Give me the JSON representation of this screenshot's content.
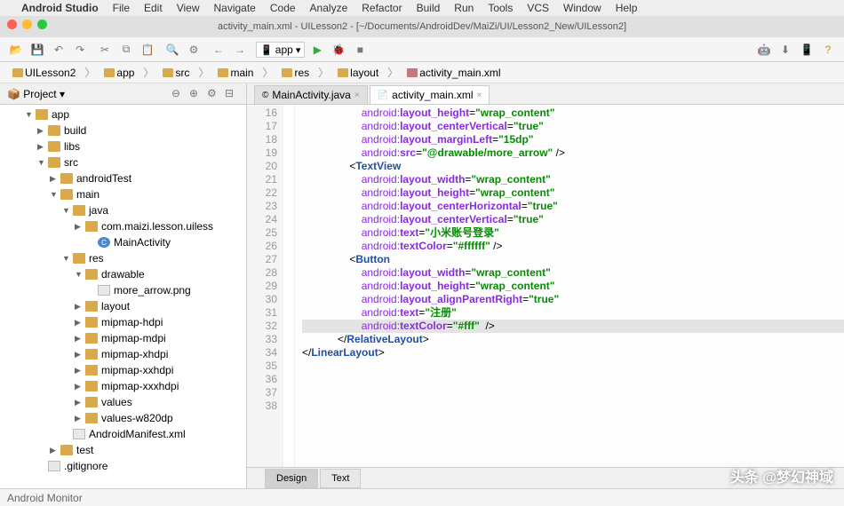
{
  "menubar": [
    "Android Studio",
    "File",
    "Edit",
    "View",
    "Navigate",
    "Code",
    "Analyze",
    "Refactor",
    "Build",
    "Run",
    "Tools",
    "VCS",
    "Window",
    "Help"
  ],
  "title": "activity_main.xml - UILesson2 - [~/Documents/AndroidDev/MaiZi/UI/Lesson2_New/UILesson2]",
  "run_config": "app",
  "breadcrumb": [
    "UILesson2",
    "app",
    "src",
    "main",
    "res",
    "layout",
    "activity_main.xml"
  ],
  "project": {
    "panel_title": "Project"
  },
  "tree": [
    {
      "d": 2,
      "e": 1,
      "t": "dir",
      "l": "app"
    },
    {
      "d": 3,
      "e": 0,
      "t": "dir",
      "l": "build"
    },
    {
      "d": 3,
      "e": 0,
      "t": "dir",
      "l": "libs"
    },
    {
      "d": 3,
      "e": 1,
      "t": "dir",
      "l": "src"
    },
    {
      "d": 4,
      "e": 0,
      "t": "dir",
      "l": "androidTest"
    },
    {
      "d": 4,
      "e": 1,
      "t": "dir",
      "l": "main"
    },
    {
      "d": 5,
      "e": 1,
      "t": "dir",
      "l": "java"
    },
    {
      "d": 6,
      "e": 0,
      "t": "dir",
      "l": "com.maizi.lesson.uiless"
    },
    {
      "d": 7,
      "e": 0,
      "t": "java",
      "l": "MainActivity"
    },
    {
      "d": 5,
      "e": 1,
      "t": "dir",
      "l": "res"
    },
    {
      "d": 6,
      "e": 1,
      "t": "dir",
      "l": "drawable"
    },
    {
      "d": 7,
      "e": 0,
      "t": "file",
      "l": "more_arrow.png"
    },
    {
      "d": 6,
      "e": 0,
      "t": "dir",
      "l": "layout"
    },
    {
      "d": 6,
      "e": 0,
      "t": "dir",
      "l": "mipmap-hdpi"
    },
    {
      "d": 6,
      "e": 0,
      "t": "dir",
      "l": "mipmap-mdpi"
    },
    {
      "d": 6,
      "e": 0,
      "t": "dir",
      "l": "mipmap-xhdpi"
    },
    {
      "d": 6,
      "e": 0,
      "t": "dir",
      "l": "mipmap-xxhdpi"
    },
    {
      "d": 6,
      "e": 0,
      "t": "dir",
      "l": "mipmap-xxxhdpi"
    },
    {
      "d": 6,
      "e": 0,
      "t": "dir",
      "l": "values"
    },
    {
      "d": 6,
      "e": 0,
      "t": "dir",
      "l": "values-w820dp"
    },
    {
      "d": 5,
      "e": 0,
      "t": "file",
      "l": "AndroidManifest.xml"
    },
    {
      "d": 4,
      "e": 0,
      "t": "dir",
      "l": "test"
    },
    {
      "d": 3,
      "e": 0,
      "t": "file",
      "l": ".gitignore"
    }
  ],
  "tabs": [
    {
      "label": "MainActivity.java",
      "active": false,
      "type": "java"
    },
    {
      "label": "activity_main.xml",
      "active": true,
      "type": "xml"
    }
  ],
  "bottom_tabs": [
    {
      "label": "Design",
      "active": true
    },
    {
      "label": "Text",
      "active": false
    }
  ],
  "statusbar_left": "Android Monitor",
  "watermark": "头条 @梦幻神域",
  "code": {
    "first_line": 16,
    "lines": [
      [
        [
          1,
          "                    "
        ],
        [
          2,
          "android:"
        ],
        [
          3,
          "layout_height"
        ],
        [
          1,
          "="
        ],
        [
          4,
          "\"wrap_content\""
        ],
        [
          1,
          ""
        ]
      ],
      [
        [
          1,
          "                    "
        ],
        [
          2,
          "android:"
        ],
        [
          3,
          "layout_centerVertical"
        ],
        [
          1,
          "="
        ],
        [
          4,
          "\"true\""
        ],
        [
          1,
          ""
        ]
      ],
      [
        [
          1,
          "                    "
        ],
        [
          2,
          "android:"
        ],
        [
          3,
          "layout_marginLeft"
        ],
        [
          1,
          "="
        ],
        [
          4,
          "\"15dp\""
        ],
        [
          1,
          ""
        ]
      ],
      [
        [
          1,
          "                    "
        ],
        [
          2,
          "android:"
        ],
        [
          3,
          "src"
        ],
        [
          1,
          "="
        ],
        [
          4,
          "\"@drawable/more_arrow\""
        ],
        [
          1,
          " />"
        ]
      ],
      [
        [
          1,
          ""
        ]
      ],
      [
        [
          1,
          "                <"
        ],
        [
          5,
          "TextView"
        ],
        [
          1,
          ""
        ]
      ],
      [
        [
          1,
          "                    "
        ],
        [
          2,
          "android:"
        ],
        [
          3,
          "layout_width"
        ],
        [
          1,
          "="
        ],
        [
          4,
          "\"wrap_content\""
        ],
        [
          1,
          ""
        ]
      ],
      [
        [
          1,
          "                    "
        ],
        [
          2,
          "android:"
        ],
        [
          3,
          "layout_height"
        ],
        [
          1,
          "="
        ],
        [
          4,
          "\"wrap_content\""
        ],
        [
          1,
          ""
        ]
      ],
      [
        [
          1,
          "                    "
        ],
        [
          2,
          "android:"
        ],
        [
          3,
          "layout_centerHorizontal"
        ],
        [
          1,
          "="
        ],
        [
          4,
          "\"true\""
        ],
        [
          1,
          ""
        ]
      ],
      [
        [
          1,
          "                    "
        ],
        [
          2,
          "android:"
        ],
        [
          3,
          "layout_centerVertical"
        ],
        [
          1,
          "="
        ],
        [
          4,
          "\"true\""
        ],
        [
          1,
          ""
        ]
      ],
      [
        [
          1,
          "                    "
        ],
        [
          2,
          "android:"
        ],
        [
          3,
          "text"
        ],
        [
          1,
          "="
        ],
        [
          6,
          "\"小米账号登录\""
        ],
        [
          1,
          ""
        ]
      ],
      [
        [
          1,
          "                    "
        ],
        [
          2,
          "android:"
        ],
        [
          3,
          "textColor"
        ],
        [
          1,
          "="
        ],
        [
          4,
          "\"#ffffff\""
        ],
        [
          1,
          " />"
        ]
      ],
      [
        [
          1,
          ""
        ]
      ],
      [
        [
          1,
          "                <"
        ],
        [
          5,
          "Button"
        ],
        [
          1,
          ""
        ]
      ],
      [
        [
          1,
          "                    "
        ],
        [
          2,
          "android:"
        ],
        [
          3,
          "layout_width"
        ],
        [
          1,
          "="
        ],
        [
          4,
          "\"wrap_content\""
        ],
        [
          1,
          ""
        ]
      ],
      [
        [
          1,
          "                    "
        ],
        [
          2,
          "android:"
        ],
        [
          3,
          "layout_height"
        ],
        [
          1,
          "="
        ],
        [
          4,
          "\"wrap_content\""
        ],
        [
          1,
          ""
        ]
      ],
      [
        [
          1,
          "                    "
        ],
        [
          2,
          "android:"
        ],
        [
          3,
          "layout_alignParentRight"
        ],
        [
          1,
          "="
        ],
        [
          4,
          "\"true\""
        ],
        [
          1,
          ""
        ]
      ],
      [
        [
          1,
          "                    "
        ],
        [
          2,
          "android:"
        ],
        [
          3,
          "text"
        ],
        [
          1,
          "="
        ],
        [
          6,
          "\"注册\""
        ],
        [
          1,
          ""
        ]
      ],
      [
        [
          1,
          "                    "
        ],
        [
          2,
          "android:"
        ],
        [
          3,
          "textColor"
        ],
        [
          1,
          "="
        ],
        [
          4,
          "\"#fff\""
        ],
        [
          1,
          "  />"
        ]
      ],
      [
        [
          1,
          ""
        ]
      ],
      [
        [
          1,
          "            </"
        ],
        [
          5,
          "RelativeLayout"
        ],
        [
          1,
          ">"
        ]
      ],
      [
        [
          1,
          "</"
        ],
        [
          5,
          "LinearLayout"
        ],
        [
          1,
          ">"
        ]
      ],
      [
        [
          1,
          ""
        ]
      ]
    ]
  }
}
